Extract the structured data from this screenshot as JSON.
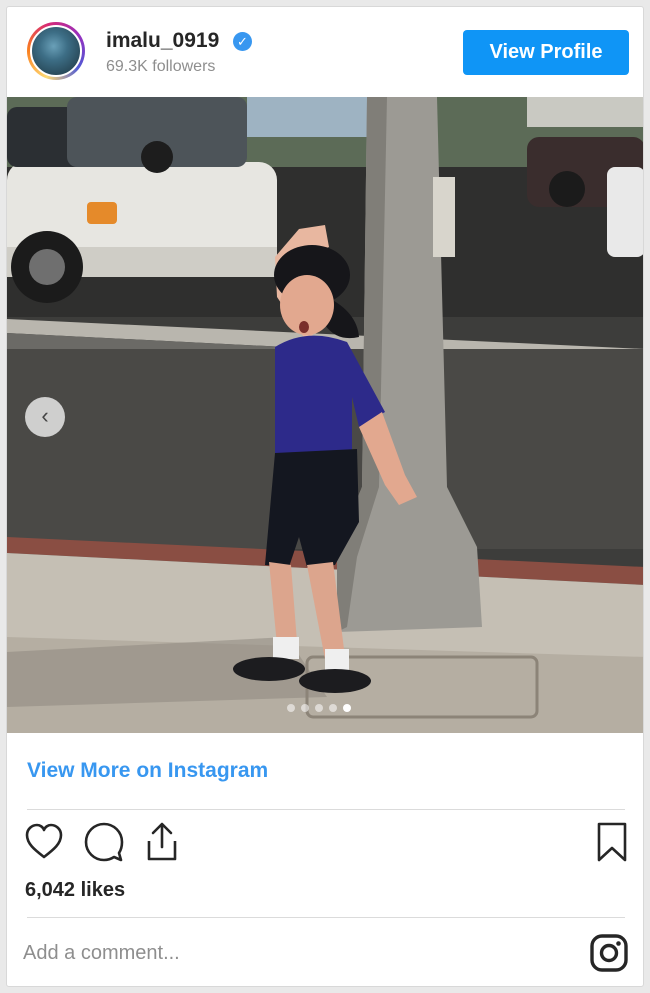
{
  "post": {
    "username": "imalu_0919",
    "verified_glyph": "✓",
    "followers": "69.3K followers",
    "view_profile_label": "View Profile",
    "view_more_label": "View More on Instagram",
    "likes": "6,042 likes",
    "comment_placeholder": "Add a comment...",
    "carousel": {
      "total": 5,
      "active_index": 4
    },
    "prev_glyph": "‹"
  },
  "icons": {
    "avatar": "avatar",
    "verified": "verified-badge-icon",
    "like": "heart-icon",
    "comment": "comment-bubble-icon",
    "share": "share-icon",
    "save": "bookmark-icon",
    "instagram": "instagram-logo-icon",
    "prev": "chevron-left-icon"
  },
  "colors": {
    "accent": "#3897f0",
    "button": "#0f95f6",
    "text": "#262626",
    "muted": "#8e8e8e"
  }
}
